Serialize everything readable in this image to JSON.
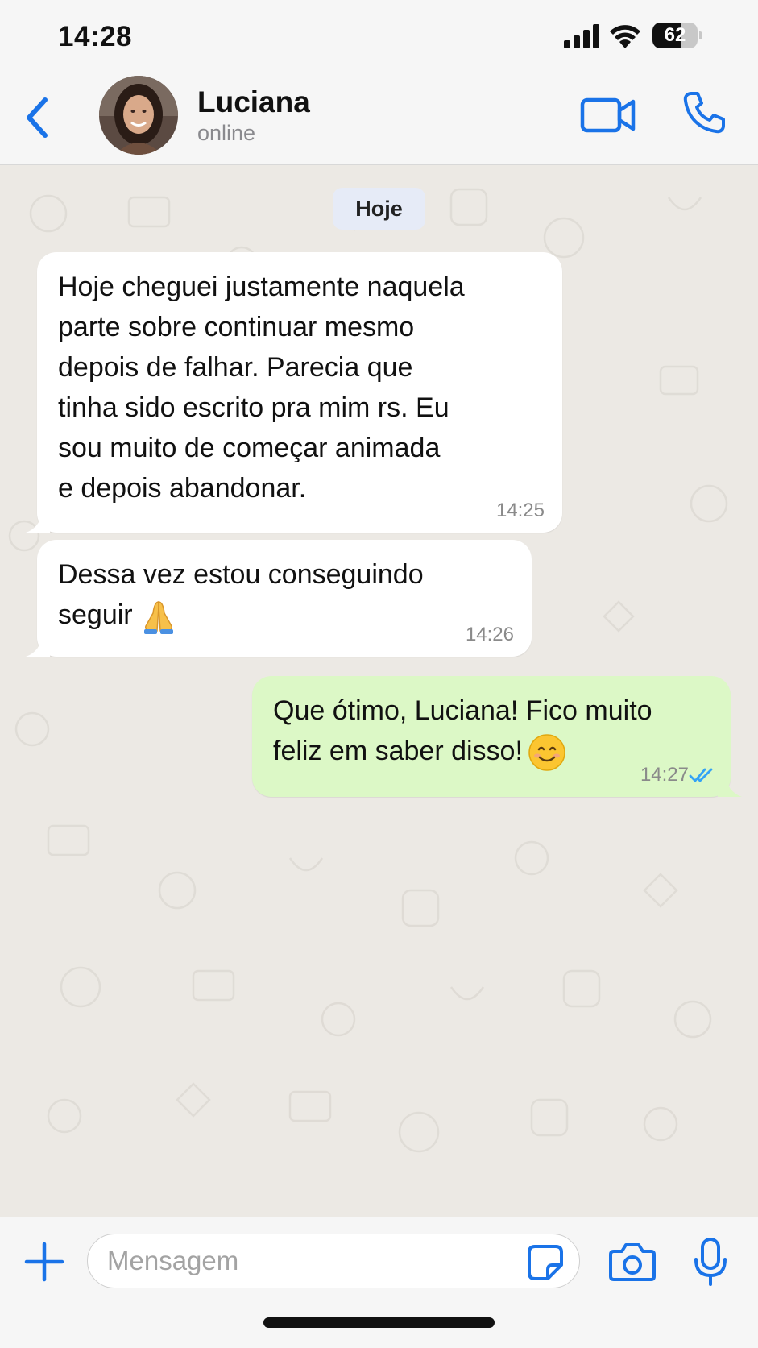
{
  "status_bar": {
    "time": "14:28",
    "battery_percent": "62",
    "battery_level": 0.62,
    "signal_icon": "signal-bars-icon",
    "wifi_icon": "wifi-icon",
    "battery_icon": "battery-icon"
  },
  "header": {
    "contact_name": "Luciana",
    "contact_status": "online",
    "back_icon": "chevron-left-icon",
    "video_icon": "video-camera-icon",
    "call_icon": "phone-icon"
  },
  "chat": {
    "date_label": "Hoje",
    "messages": [
      {
        "direction": "incoming",
        "text": "Hoje cheguei justamente naquela\nparte sobre continuar mesmo\ndepois de falhar. Parecia que\ntinha sido escrito pra mim rs. Eu\nsou muito de começar animada\ne depois abandonar.",
        "time": "14:25"
      },
      {
        "direction": "incoming",
        "text": "Dessa vez estou conseguindo\nseguir",
        "emoji": "folded-hands-emoji",
        "time": "14:26"
      },
      {
        "direction": "outgoing",
        "text": "Que ótimo, Luciana! Fico muito\nfeliz em saber disso!",
        "emoji": "smiling-face-emoji",
        "time": "14:27",
        "status_icon": "double-check-read-icon"
      }
    ]
  },
  "composer": {
    "placeholder": "Mensagem",
    "value": "",
    "plus_icon": "plus-icon",
    "sticker_icon": "sticker-icon",
    "camera_icon": "camera-icon",
    "mic_icon": "microphone-icon"
  },
  "colors": {
    "accent": "#1a73e8",
    "incoming_bubble": "#ffffff",
    "outgoing_bubble": "#dcf8c6",
    "chat_background": "#ece9e4",
    "read_check": "#34a3f5"
  }
}
